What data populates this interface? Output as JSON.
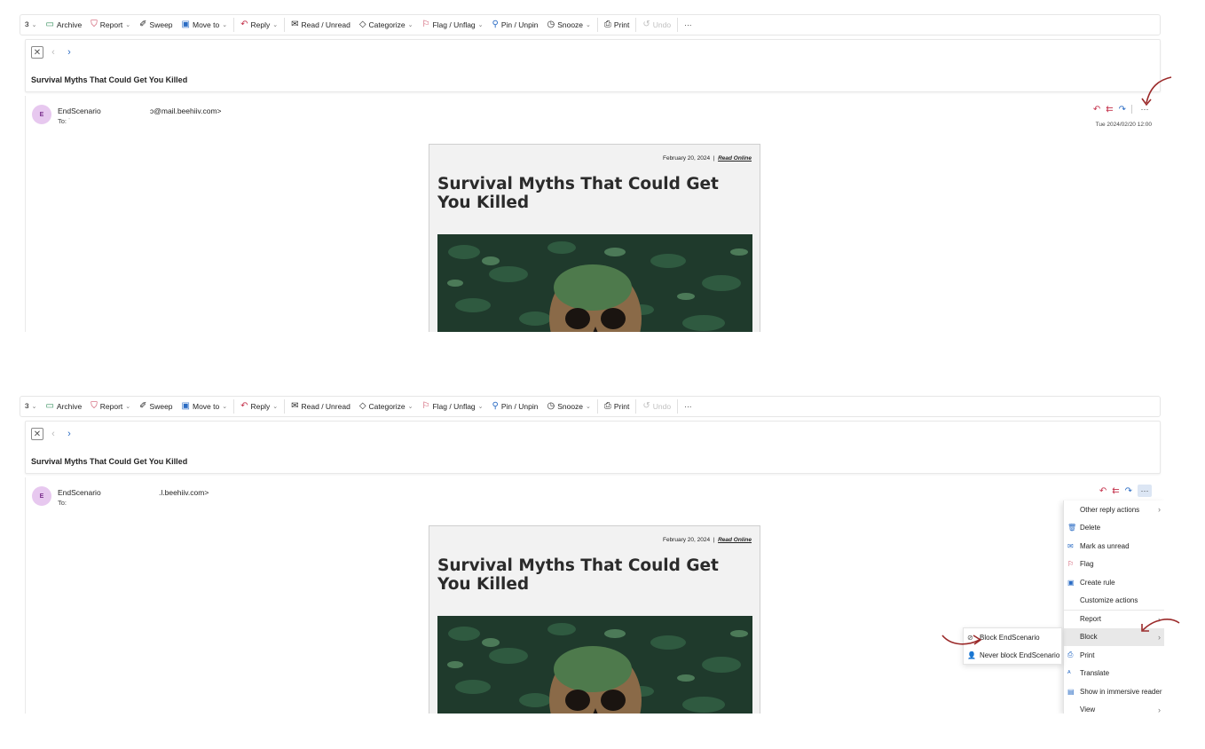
{
  "toolbar": {
    "items": [
      {
        "label": "",
        "icon": "dropdown"
      },
      {
        "label": "Archive",
        "icon": "archive-icon"
      },
      {
        "label": "Report",
        "icon": "report-icon"
      },
      {
        "label": "Sweep",
        "icon": "sweep-icon"
      },
      {
        "label": "Move to",
        "icon": "move-icon"
      },
      {
        "label": "Reply",
        "icon": "reply-icon"
      },
      {
        "label": "Read / Unread",
        "icon": "mail-icon"
      },
      {
        "label": "Categorize",
        "icon": "tag-icon"
      },
      {
        "label": "Flag / Unflag",
        "icon": "flag-icon"
      },
      {
        "label": "Pin / Unpin",
        "icon": "pin-icon"
      },
      {
        "label": "Snooze",
        "icon": "clock-icon"
      },
      {
        "label": "Print",
        "icon": "print-icon"
      },
      {
        "label": "Undo",
        "icon": "undo-icon"
      },
      {
        "label": "···",
        "icon": "more-icon"
      }
    ]
  },
  "subject": "Survival Myths That Could Get You Killed",
  "top": {
    "sender_name": "EndScenario",
    "sender_email": "ɔ@mail.beehiiv.com>",
    "to": "To: ˙",
    "date": "Tue 2024/02/20 12:00"
  },
  "bottom": {
    "sender_name": "EndScenario",
    "sender_email": ".l.beehiiv.com>",
    "to": "To:"
  },
  "avatar_letter": "E",
  "email": {
    "date": "February 20, 2024",
    "separator": "|",
    "read_online": "Read Online",
    "headline": "Survival Myths That Could Get You Killed"
  },
  "menu": {
    "items": [
      {
        "label": "Other reply actions",
        "icon": "",
        "chevron": true
      },
      {
        "label": "Delete",
        "icon": "trash-icon",
        "chevron": false
      },
      {
        "label": "Mark as unread",
        "icon": "mail-icon",
        "chevron": false
      },
      {
        "label": "Flag",
        "icon": "flag-icon",
        "chevron": false
      },
      {
        "label": "Create rule",
        "icon": "rule-icon",
        "chevron": false
      },
      {
        "label": "Customize actions",
        "icon": "",
        "chevron": false
      },
      {
        "label": "Report",
        "icon": "",
        "chevron": true
      },
      {
        "label": "Block",
        "icon": "",
        "chevron": true
      },
      {
        "label": "Print",
        "icon": "print-icon",
        "chevron": false
      },
      {
        "label": "Translate",
        "icon": "translate-icon",
        "chevron": false
      },
      {
        "label": "Show in immersive reader",
        "icon": "reader-icon",
        "chevron": false
      },
      {
        "label": "View",
        "icon": "",
        "chevron": true
      }
    ]
  },
  "submenu": {
    "items": [
      {
        "label": "Block EndScenario"
      },
      {
        "label": "Never block EndScenario"
      }
    ]
  },
  "colors": {
    "accent": "#2b6cc4",
    "reply_red": "#c4314b",
    "avatar_bg": "#e7c8ef",
    "annotation": "#9b2a2a"
  }
}
